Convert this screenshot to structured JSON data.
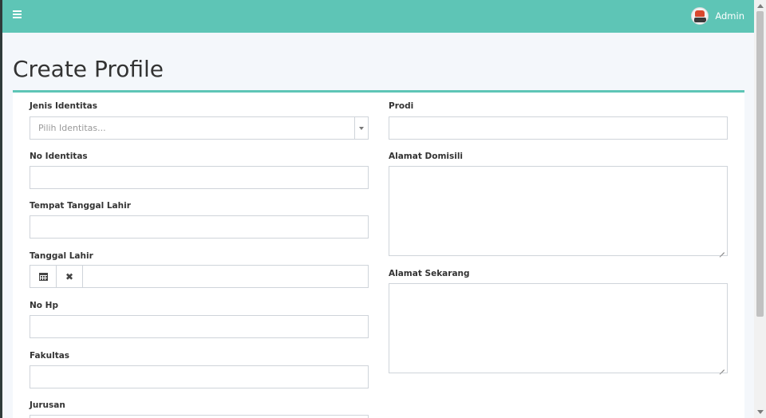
{
  "header": {
    "user_name": "Admin"
  },
  "page": {
    "title": "Create Profile"
  },
  "form": {
    "jenis_identitas": {
      "label": "Jenis Identitas",
      "placeholder": "Pilih Identitas..."
    },
    "no_identitas": {
      "label": "No Identitas",
      "value": ""
    },
    "tempat_tanggal_lahir": {
      "label": "Tempat Tanggal Lahir",
      "value": ""
    },
    "tanggal_lahir": {
      "label": "Tanggal Lahir",
      "value": ""
    },
    "no_hp": {
      "label": "No Hp",
      "value": ""
    },
    "fakultas": {
      "label": "Fakultas",
      "value": ""
    },
    "jurusan": {
      "label": "Jurusan",
      "value": ""
    },
    "prodi": {
      "label": "Prodi",
      "value": ""
    },
    "alamat_domisili": {
      "label": "Alamat Domisili",
      "value": ""
    },
    "alamat_sekarang": {
      "label": "Alamat Sekarang",
      "value": ""
    }
  },
  "icons": {
    "menu": "hamburger-menu-icon",
    "calendar": "calendar-icon",
    "clear": "close-icon",
    "dropdown": "chevron-down-icon"
  },
  "colors": {
    "accent": "#5ec5b6"
  }
}
